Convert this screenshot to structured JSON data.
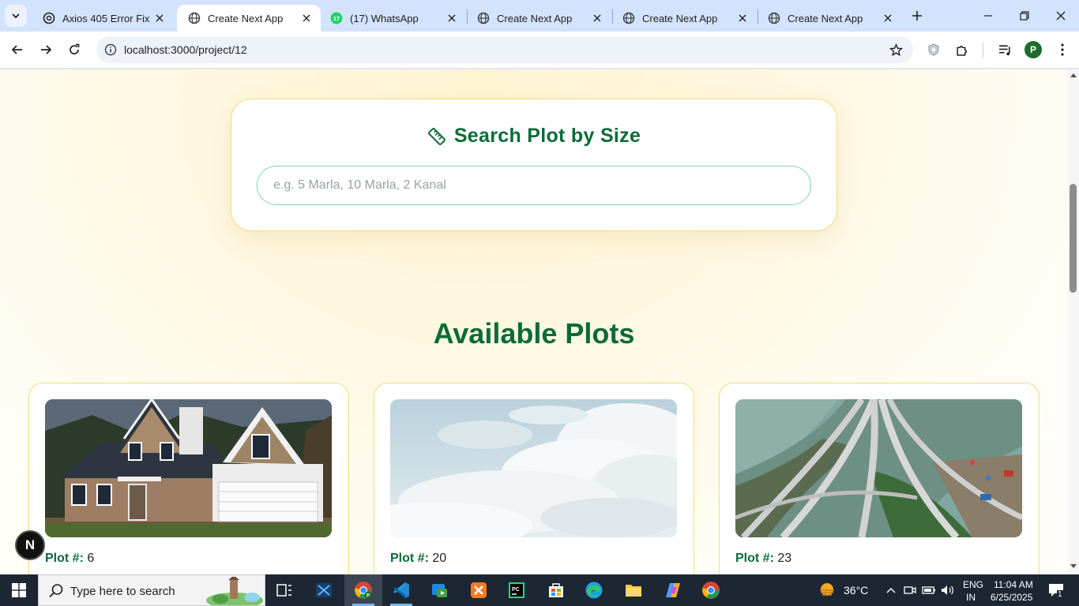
{
  "browser": {
    "tabs": [
      {
        "title": "Axios 405 Error Fix",
        "favicon": "openai-icon",
        "active": false
      },
      {
        "title": "Create Next App",
        "favicon": "globe-icon",
        "active": true
      },
      {
        "title": "(17) WhatsApp",
        "favicon": "whatsapp-icon",
        "active": false,
        "badge": "17"
      },
      {
        "title": "Create Next App",
        "favicon": "globe-icon",
        "active": false
      },
      {
        "title": "Create Next App",
        "favicon": "globe-icon",
        "active": false
      },
      {
        "title": "Create Next App",
        "favicon": "globe-icon",
        "active": false
      }
    ],
    "url": "localhost:3000/project/12",
    "profile_initial": "P"
  },
  "page": {
    "search": {
      "title": "Search Plot by Size",
      "placeholder": "e.g. 5 Marla, 10 Marla, 2 Kanal",
      "value": ""
    },
    "section_title": "Available Plots",
    "plot_label": "Plot #:",
    "plots": [
      {
        "number": "6",
        "image": "house-photo"
      },
      {
        "number": "20",
        "image": "clouds-photo"
      },
      {
        "number": "23",
        "image": "highway-aerial-photo"
      }
    ],
    "dev_badge": "N"
  },
  "taskbar": {
    "search_placeholder": "Type here to search",
    "weather": "36°C",
    "lang_line1": "ENG",
    "lang_line2": "IN",
    "time": "11:04 AM",
    "date": "6/25/2025",
    "notification_count": "1"
  },
  "colors": {
    "accent_green": "#0b6b38",
    "card_border": "#f4dc7a",
    "input_border": "#7fd6a6"
  }
}
